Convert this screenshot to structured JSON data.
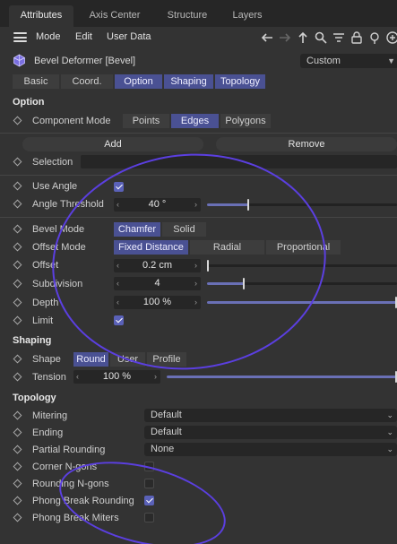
{
  "tabs": [
    "Attributes",
    "Axis Center",
    "Structure",
    "Layers"
  ],
  "menu": [
    "Mode",
    "Edit",
    "User Data"
  ],
  "object": {
    "title": "Bevel Deformer [Bevel]",
    "preset": "Custom"
  },
  "subtabs": [
    "Basic",
    "Coord.",
    "Option",
    "Shaping",
    "Topology"
  ],
  "option": {
    "title": "Option",
    "component_mode_label": "Component Mode",
    "component_modes": [
      "Points",
      "Edges",
      "Polygons"
    ],
    "add_label": "Add",
    "remove_label": "Remove",
    "selection_label": "Selection",
    "selection_value": "",
    "use_angle_label": "Use Angle",
    "use_angle": true,
    "angle_threshold_label": "Angle Threshold",
    "angle_threshold_value": "40 °",
    "angle_threshold_fraction": 0.22,
    "bevel_mode_label": "Bevel Mode",
    "bevel_modes": [
      "Chamfer",
      "Solid"
    ],
    "offset_mode_label": "Offset Mode",
    "offset_modes": [
      "Fixed Distance",
      "Radial",
      "Proportional"
    ],
    "offset_label": "Offset",
    "offset_value": "0.2 cm",
    "offset_fraction": 0.01,
    "subdivision_label": "Subdivision",
    "subdivision_value": "4",
    "subdivision_fraction": 0.2,
    "depth_label": "Depth",
    "depth_value": "100 %",
    "depth_fraction": 1.0,
    "limit_label": "Limit",
    "limit": true
  },
  "shaping": {
    "title": "Shaping",
    "shape_label": "Shape",
    "shapes": [
      "Round",
      "User",
      "Profile"
    ],
    "tension_label": "Tension",
    "tension_value": "100 %",
    "tension_fraction": 1.0
  },
  "topology": {
    "title": "Topology",
    "mitering_label": "Mitering",
    "mitering_value": "Default",
    "ending_label": "Ending",
    "ending_value": "Default",
    "partial_rounding_label": "Partial Rounding",
    "partial_rounding_value": "None",
    "corner_ngons_label": "Corner N-gons",
    "corner_ngons": false,
    "rounding_ngons_label": "Rounding N-gons",
    "rounding_ngons": false,
    "phong_break_rounding_label": "Phong Break Rounding",
    "phong_break_rounding": true,
    "phong_break_miters_label": "Phong Break Miters",
    "phong_break_miters": false
  },
  "colors": {
    "accent": "#4a5193",
    "annotation": "#5b3fe0",
    "background": "#333333"
  }
}
